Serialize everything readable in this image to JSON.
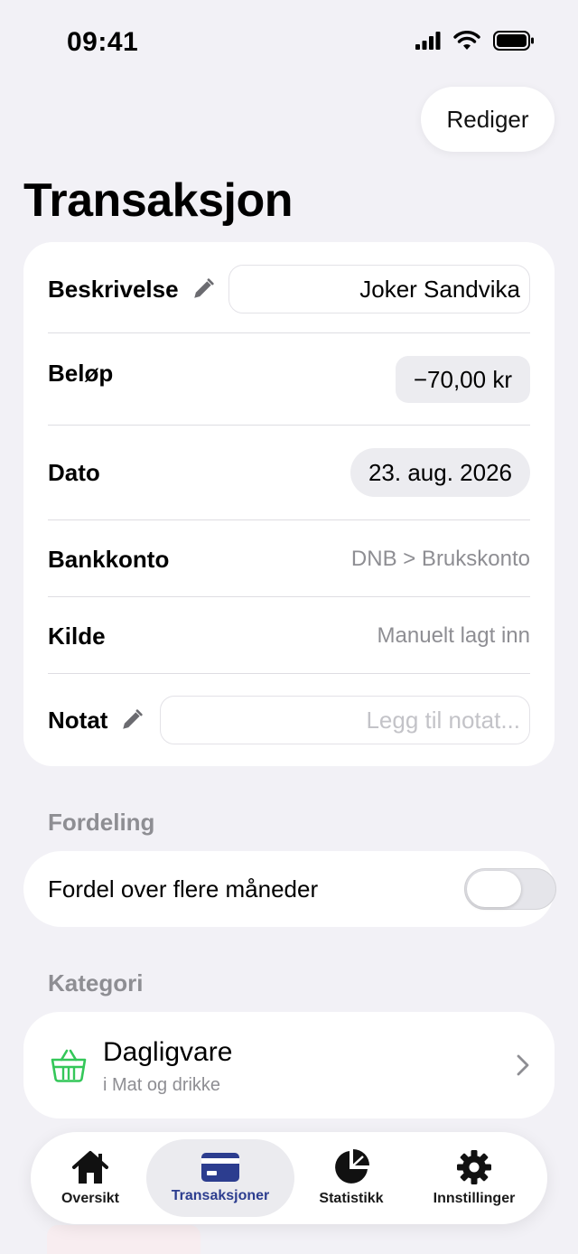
{
  "status_bar": {
    "time": "09:41"
  },
  "header": {
    "edit_label": "Rediger",
    "title": "Transaksjon"
  },
  "details": {
    "description": {
      "label": "Beskrivelse",
      "value": "Joker Sandvika"
    },
    "amount": {
      "label": "Beløp",
      "value": "−70,00 kr"
    },
    "date": {
      "label": "Dato",
      "value": "23. aug. 2026"
    },
    "bank_account": {
      "label": "Bankkonto",
      "value": "DNB > Brukskonto"
    },
    "source": {
      "label": "Kilde",
      "value": "Manuelt lagt inn"
    },
    "note": {
      "label": "Notat",
      "placeholder": "Legg til notat..."
    }
  },
  "distribution": {
    "section_title": "Fordeling",
    "toggle_label": "Fordel over flere måneder",
    "toggle_on": false
  },
  "category": {
    "section_title": "Kategori",
    "name": "Dagligvare",
    "parent": "i Mat og drikke",
    "icon": "basket-icon",
    "icon_color": "#34c759"
  },
  "tabbar": {
    "tabs": [
      {
        "label": "Oversikt",
        "icon": "house-icon"
      },
      {
        "label": "Transaksjoner",
        "icon": "card-icon",
        "active": true
      },
      {
        "label": "Statistikk",
        "icon": "pie-chart-icon"
      },
      {
        "label": "Innstillinger",
        "icon": "gear-icon"
      }
    ]
  },
  "colors": {
    "accent": "#2c3d8f",
    "background": "#f2f1f6"
  }
}
